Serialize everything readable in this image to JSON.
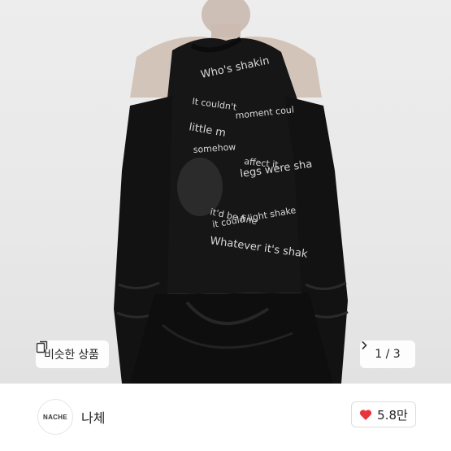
{
  "carousel": {
    "similar_label": "비슷한 상품",
    "pager_text": "1 / 3",
    "similar_icon": "similar-items-icon",
    "next_icon": "chevron-right-icon"
  },
  "seller": {
    "logo_text": "NACHE",
    "name": "나체"
  },
  "likes": {
    "count": "5.8만",
    "icon": "heart-icon",
    "color": "#e8353b"
  },
  "print_text": [
    "Who's shakin",
    "It couldn't",
    "moment coul",
    "little m",
    "somehow",
    "affect it",
    "legs were sha",
    "it'd be fine",
    "it could light shake",
    "Whatever it's shak"
  ]
}
